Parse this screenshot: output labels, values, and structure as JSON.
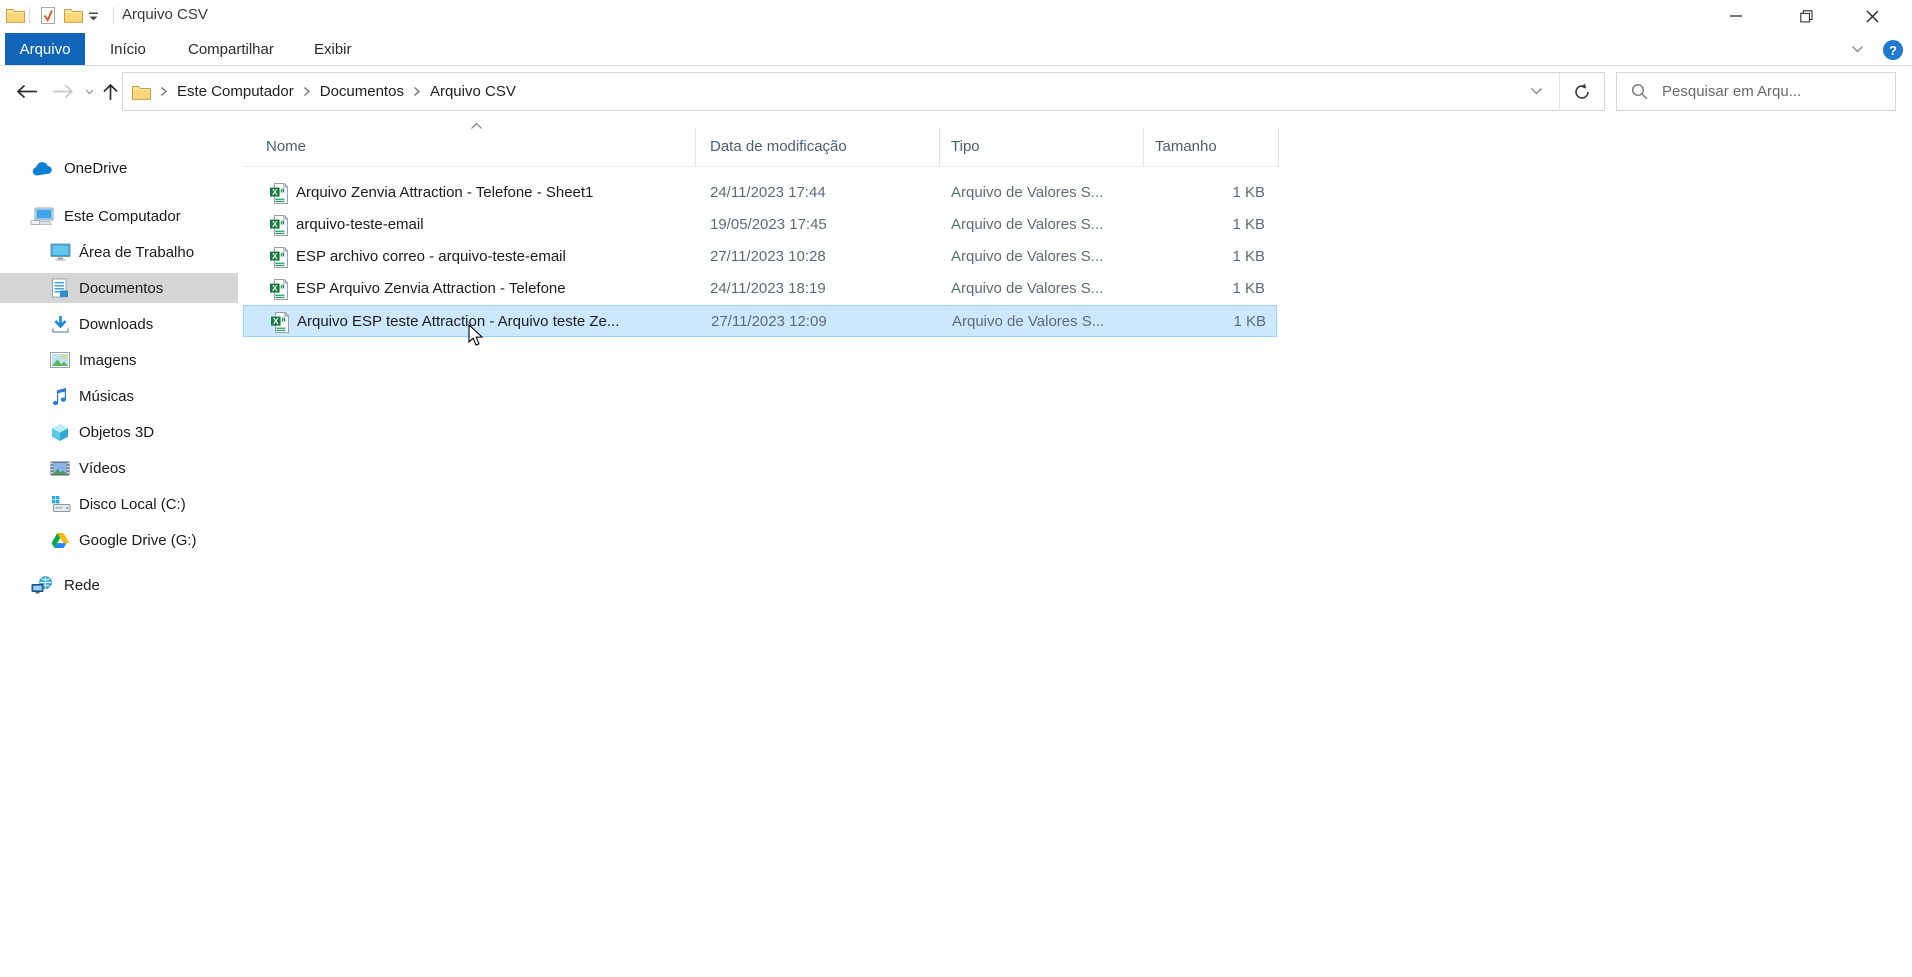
{
  "window": {
    "title": "Arquivo CSV"
  },
  "ribbon": {
    "tabs": [
      {
        "label": "Arquivo",
        "active": true
      },
      {
        "label": "Início",
        "active": false
      },
      {
        "label": "Compartilhar",
        "active": false
      },
      {
        "label": "Exibir",
        "active": false
      }
    ],
    "help_label": "?"
  },
  "toolbar": {
    "breadcrumb": [
      "Este Computador",
      "Documentos",
      "Arquivo CSV"
    ],
    "search_placeholder": "Pesquisar em Arqu..."
  },
  "sidebar": {
    "items": [
      {
        "label": "OneDrive",
        "icon": "onedrive-icon",
        "level": 0,
        "selected": false
      },
      {
        "label": "Este Computador",
        "icon": "computer-icon",
        "level": 0,
        "selected": false
      },
      {
        "label": "Área de Trabalho",
        "icon": "desktop-icon",
        "level": 1,
        "selected": false
      },
      {
        "label": "Documentos",
        "icon": "documents-icon",
        "level": 1,
        "selected": true
      },
      {
        "label": "Downloads",
        "icon": "downloads-icon",
        "level": 1,
        "selected": false
      },
      {
        "label": "Imagens",
        "icon": "pictures-icon",
        "level": 1,
        "selected": false
      },
      {
        "label": "Músicas",
        "icon": "music-icon",
        "level": 1,
        "selected": false
      },
      {
        "label": "Objetos 3D",
        "icon": "objects3d-icon",
        "level": 1,
        "selected": false
      },
      {
        "label": "Vídeos",
        "icon": "videos-icon",
        "level": 1,
        "selected": false
      },
      {
        "label": "Disco Local (C:)",
        "icon": "local-disk-icon",
        "level": 1,
        "selected": false
      },
      {
        "label": "Google Drive (G:)",
        "icon": "google-drive-icon",
        "level": 1,
        "selected": false
      },
      {
        "label": "Rede",
        "icon": "network-icon",
        "level": 0,
        "selected": false
      }
    ]
  },
  "files": {
    "columns": [
      {
        "label": "Nome",
        "sort": "asc"
      },
      {
        "label": "Data de modificação",
        "sort": null
      },
      {
        "label": "Tipo",
        "sort": null
      },
      {
        "label": "Tamanho",
        "sort": null
      }
    ],
    "rows": [
      {
        "name": "Arquivo Zenvia Attraction - Telefone - Sheet1",
        "modified": "24/11/2023 17:44",
        "type": "Arquivo de Valores S...",
        "size": "1 KB",
        "selected": false
      },
      {
        "name": "arquivo-teste-email",
        "modified": "19/05/2023 17:45",
        "type": "Arquivo de Valores S...",
        "size": "1 KB",
        "selected": false
      },
      {
        "name": "ESP archivo correo  - arquivo-teste-email",
        "modified": "27/11/2023 10:28",
        "type": "Arquivo de Valores S...",
        "size": "1 KB",
        "selected": false
      },
      {
        "name": "ESP Arquivo Zenvia Attraction - Telefone",
        "modified": "24/11/2023 18:19",
        "type": "Arquivo de Valores S...",
        "size": "1 KB",
        "selected": false
      },
      {
        "name": "Arquivo ESP teste Attraction - Arquivo teste Ze...",
        "modified": "27/11/2023 12:09",
        "type": "Arquivo de Valores S...",
        "size": "1 KB",
        "selected": true
      }
    ]
  },
  "colors": {
    "accent_tab": "#1165b8",
    "selection_bg": "#cce8ff",
    "selection_border": "#99d1ff",
    "sidebar_selected_bg": "#d5d5d5",
    "csv_icon_green": "#107c41"
  }
}
